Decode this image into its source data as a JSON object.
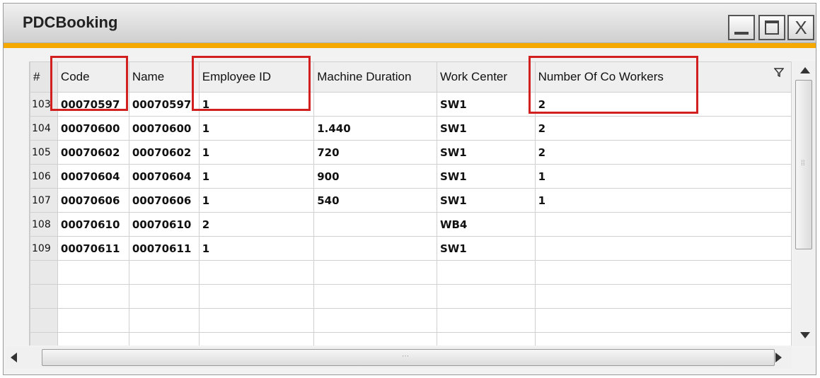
{
  "window": {
    "title": "PDCBooking",
    "close_label": "X"
  },
  "grid": {
    "columns": [
      {
        "key": "num",
        "label": "#"
      },
      {
        "key": "code",
        "label": "Code"
      },
      {
        "key": "name",
        "label": "Name"
      },
      {
        "key": "employee_id",
        "label": "Employee ID"
      },
      {
        "key": "machine_duration",
        "label": "Machine Duration"
      },
      {
        "key": "work_center",
        "label": "Work Center"
      },
      {
        "key": "co_workers",
        "label": "Number Of Co Workers"
      }
    ],
    "rows": [
      {
        "num": "103",
        "code": "00070597",
        "name": "00070597",
        "employee_id": "1",
        "machine_duration": "",
        "work_center": "SW1",
        "co_workers": "2"
      },
      {
        "num": "104",
        "code": "00070600",
        "name": "00070600",
        "employee_id": "1",
        "machine_duration": "1.440",
        "work_center": "SW1",
        "co_workers": "2"
      },
      {
        "num": "105",
        "code": "00070602",
        "name": "00070602",
        "employee_id": "1",
        "machine_duration": "720",
        "work_center": "SW1",
        "co_workers": "2"
      },
      {
        "num": "106",
        "code": "00070604",
        "name": "00070604",
        "employee_id": "1",
        "machine_duration": "900",
        "work_center": "SW1",
        "co_workers": "1"
      },
      {
        "num": "107",
        "code": "00070606",
        "name": "00070606",
        "employee_id": "1",
        "machine_duration": "540",
        "work_center": "SW1",
        "co_workers": "1"
      },
      {
        "num": "108",
        "code": "00070610",
        "name": "00070610",
        "employee_id": "2",
        "machine_duration": "",
        "work_center": "WB4",
        "co_workers": ""
      },
      {
        "num": "109",
        "code": "00070611",
        "name": "00070611",
        "employee_id": "1",
        "machine_duration": "",
        "work_center": "SW1",
        "co_workers": ""
      }
    ],
    "empty_rows": 4
  },
  "colors": {
    "accent": "#f5a800",
    "highlight": "#d21f1f"
  },
  "icons": {
    "filter": "filter-icon",
    "minimize": "minimize-icon",
    "maximize": "maximize-icon",
    "close": "close-icon"
  }
}
